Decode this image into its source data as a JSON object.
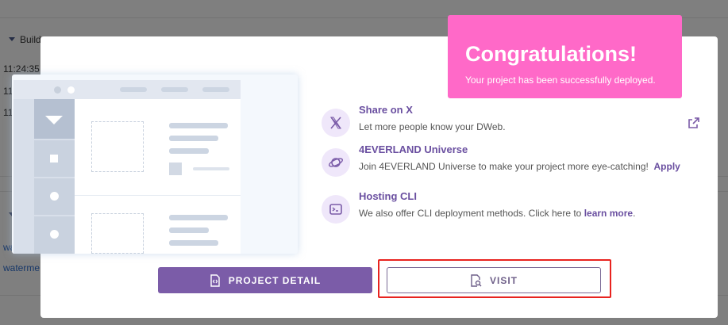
{
  "background": {
    "section_label": "Build",
    "log_lines": [
      "11:24:35",
      "11",
      "11"
    ],
    "links": [
      "wa",
      "waterme"
    ]
  },
  "modal": {
    "banner": {
      "title": "Congratulations!",
      "subtitle": "Your project has been successfully deployed."
    },
    "features": [
      {
        "title": "Share on X",
        "description": "Let more people know your DWeb.",
        "icon": "x-logo-icon"
      },
      {
        "title": "4EVERLAND Universe",
        "description_prefix": "Join 4EVERLAND Universe to make your project more eye-catching!",
        "action_label": "Apply",
        "icon": "planet-icon"
      },
      {
        "title": "Hosting CLI",
        "description_prefix": "We also offer CLI deployment methods. Click here to",
        "link_label": "learn more",
        "description_suffix": ".",
        "icon": "terminal-icon"
      }
    ],
    "buttons": {
      "project_detail": "PROJECT DETAIL",
      "visit": "VISIT"
    }
  },
  "colors": {
    "accent_purple": "#7b5ca8",
    "banner_pink": "#ff69c8",
    "highlight_red": "#e8231f"
  }
}
